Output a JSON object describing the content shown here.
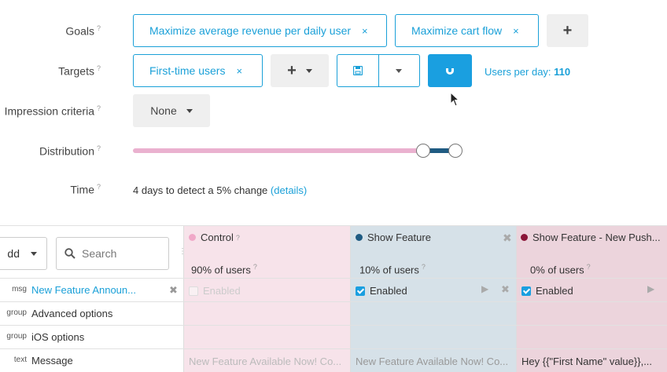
{
  "form": {
    "goals_label": "Goals",
    "targets_label": "Targets",
    "impression_label": "Impression criteria",
    "distribution_label": "Distribution",
    "time_label": "Time",
    "help_mark": "?",
    "goals": [
      "Maximize average revenue per daily user",
      "Maximize cart flow"
    ],
    "targets": [
      "First-time users"
    ],
    "remove_glyph": "×",
    "add_glyph": "+",
    "impression_value": "None",
    "users_per_day_label": "Users per day:",
    "users_per_day_value": "110",
    "time_text": "4 days to detect a 5% change",
    "details_link": "(details)"
  },
  "distribution": {
    "control": 0.9,
    "show_feature": 0.1,
    "show_feature_push": 0.0
  },
  "grid": {
    "add_label": "dd",
    "search_placeholder": "Search",
    "columns": [
      {
        "name": "Control",
        "share": "90% of users",
        "color": "#f0a8c8"
      },
      {
        "name": "Show Feature",
        "share": "10% of users",
        "color": "#1f5b82"
      },
      {
        "name": "Show Feature - New Push...",
        "share": "0% of users",
        "color": "#8a1538"
      }
    ],
    "rows": [
      {
        "type": "msg",
        "name": "New Feature Announ...",
        "cells": [
          "Enabled",
          "Enabled",
          "Enabled"
        ]
      },
      {
        "type": "group",
        "name": "Advanced options",
        "cells": [
          "",
          "",
          ""
        ]
      },
      {
        "type": "group",
        "name": "iOS options",
        "cells": [
          "",
          "",
          ""
        ]
      },
      {
        "type": "text",
        "name": "Message",
        "cells": [
          "New Feature Available Now! Co...",
          "New Feature Available Now! Co...",
          "Hey {{\"First Name\" value}},..."
        ]
      }
    ]
  },
  "colors": {
    "accent": "#1aa0d8",
    "control_bg": "#f7e3ea",
    "feature_bg": "#d6e1e8",
    "push_bg": "#ecd4dc"
  }
}
